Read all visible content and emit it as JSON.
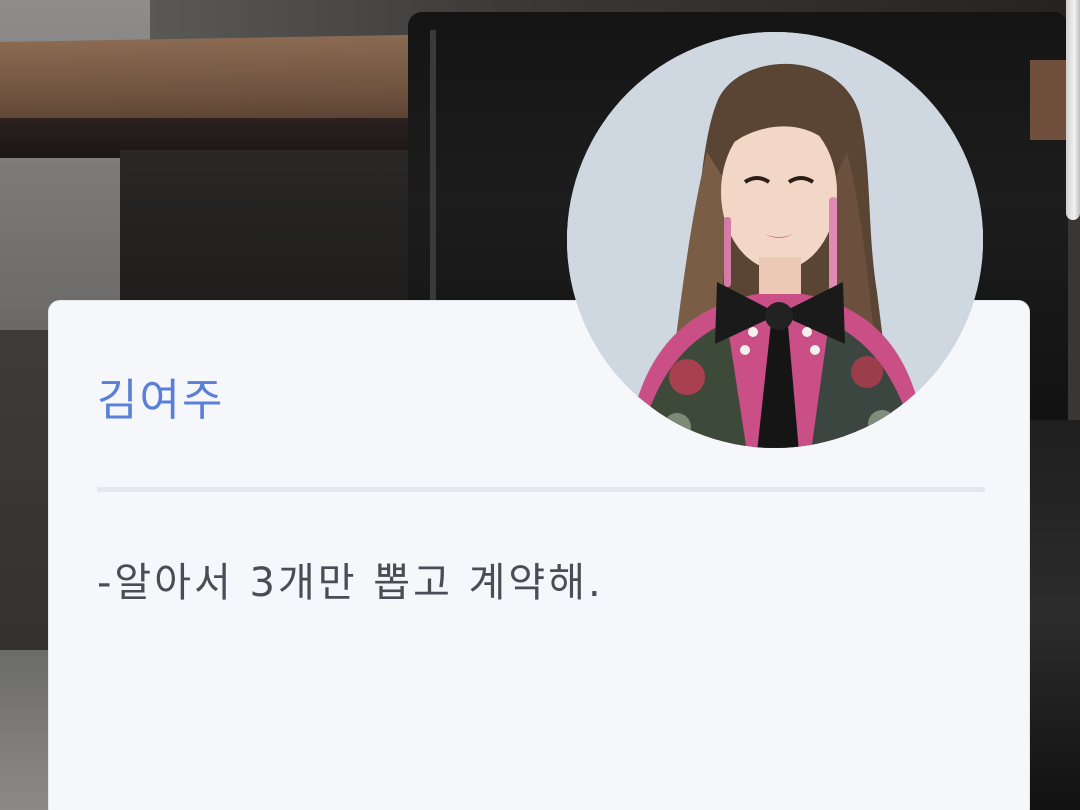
{
  "profile": {
    "name": "김여주",
    "message": "-알아서 3개만 뽑고 계약해."
  },
  "colors": {
    "name_text": "#5a7fd8",
    "message_text": "#4a4d55",
    "card_background": "#f5f7fa",
    "divider": "#e4e7ee"
  },
  "icons": {
    "avatar": "profile-photo"
  }
}
